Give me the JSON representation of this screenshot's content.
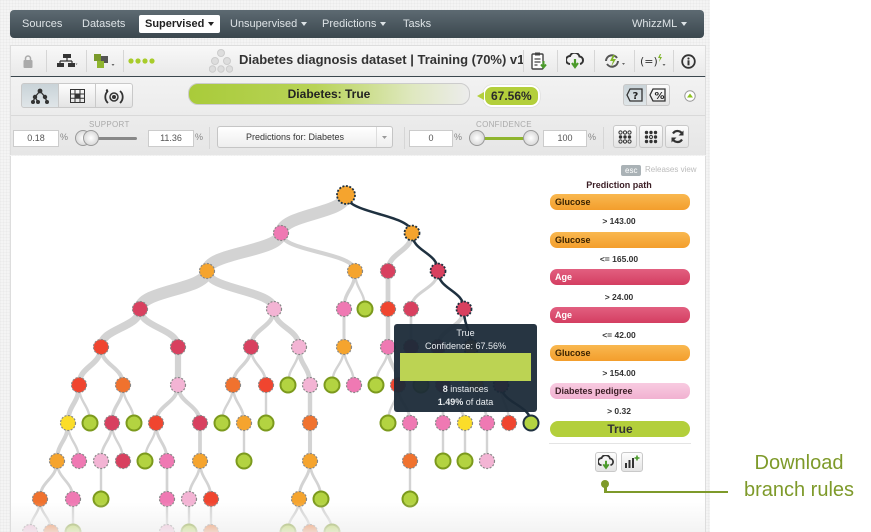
{
  "navbar": {
    "items": [
      {
        "label": "Sources",
        "active": false,
        "caret": false
      },
      {
        "label": "Datasets",
        "active": false,
        "caret": false
      },
      {
        "label": "Supervised",
        "active": true,
        "caret": true
      },
      {
        "label": "Unsupervised",
        "active": false,
        "caret": true
      },
      {
        "label": "Predictions",
        "active": false,
        "caret": true
      },
      {
        "label": "Tasks",
        "active": false,
        "caret": false
      }
    ],
    "right_menu": "WhizzML"
  },
  "toolbar": {
    "title": "Diabetes diagnosis dataset | Training (70%) v1",
    "icons": [
      "lock-icon",
      "tree-view-icon",
      "model-type-icon",
      "progress-dots-icon",
      "model-tree-icon",
      "report-download-icon",
      "cloud-download-icon",
      "batch-predict-icon",
      "formula-icon",
      "info-icon"
    ]
  },
  "view_controls": {
    "views": [
      "tree-view",
      "sunburst-grid-view",
      "radar-view"
    ],
    "prediction_label": "Diabetes: True",
    "confidence_value": "67.56%",
    "accent_color": "#b3cf3b"
  },
  "filters": {
    "support": {
      "label": "SUPPORT",
      "min": "0.18",
      "max": "11.36",
      "unit": "%"
    },
    "prediction_dropdown": "Predictions for: Diabetes",
    "confidence": {
      "label": "CONFIDENCE",
      "min": "0",
      "max": "100",
      "unit": "%"
    }
  },
  "sidebar": {
    "esc_label": "esc",
    "releases_label": "Releases view",
    "title": "Prediction path",
    "path": [
      {
        "field": "Glucose",
        "condition": "> 143.00",
        "color": "#f5a43a"
      },
      {
        "field": "Glucose",
        "condition": "<= 165.00",
        "color": "#f5a43a"
      },
      {
        "field": "Age",
        "condition": "> 24.00",
        "color": "#d94a6b"
      },
      {
        "field": "Age",
        "condition": "<= 42.00",
        "color": "#d94a6b"
      },
      {
        "field": "Glucose",
        "condition": "> 154.00",
        "color": "#f5a43a"
      },
      {
        "field": "Diabetes pedigree",
        "condition": "> 0.32",
        "color": "#f4b8d6"
      }
    ],
    "leaf": "True"
  },
  "tooltip": {
    "title": "True",
    "confidence": "Confidence: 67.56%",
    "instances_count": "8",
    "instances_label": "instances",
    "data_pct": "1.49%",
    "data_label": "of data"
  },
  "annotation": {
    "line1": "Download",
    "line2": "branch rules"
  },
  "tree": {
    "colors": {
      "O": "#f5a42e",
      "P": "#ef79b3",
      "L": "#f3b4d4",
      "R": "#d8405f",
      "E": "#f0452f",
      "D": "#f0722e",
      "Y": "#fbdd29",
      "G": "#b3d341"
    },
    "nodes": [
      [
        "n0",
        345,
        195,
        "O",
        null,
        1
      ],
      [
        "n1",
        280,
        233,
        "P",
        "n0",
        0
      ],
      [
        "n2",
        411,
        233,
        "O",
        "n0",
        1
      ],
      [
        "n3",
        206,
        271,
        "O",
        "n1",
        0
      ],
      [
        "n4",
        354,
        271,
        "O",
        "n1",
        0
      ],
      [
        "n5",
        387,
        271,
        "R",
        "n2",
        0
      ],
      [
        "n6",
        437,
        271,
        "R",
        "n2",
        1
      ],
      [
        "n7",
        139,
        309,
        "R",
        "n3",
        0
      ],
      [
        "n8",
        273,
        309,
        "L",
        "n3",
        0
      ],
      [
        "n9",
        343,
        309,
        "P",
        "n4",
        0
      ],
      [
        "n10",
        364,
        309,
        "G",
        "n4",
        0
      ],
      [
        "n11",
        387,
        309,
        "E",
        "n5",
        0
      ],
      [
        "n12",
        410,
        309,
        "R",
        "n6",
        0
      ],
      [
        "n13",
        463,
        309,
        "R",
        "n6",
        1
      ],
      [
        "n14",
        100,
        347,
        "E",
        "n7",
        0
      ],
      [
        "n15",
        177,
        347,
        "R",
        "n7",
        0
      ],
      [
        "n16",
        250,
        347,
        "R",
        "n8",
        0
      ],
      [
        "n17",
        298,
        347,
        "L",
        "n8",
        0
      ],
      [
        "n18",
        343,
        347,
        "O",
        "n9",
        0
      ],
      [
        "n19",
        387,
        347,
        "P",
        "n11",
        0
      ],
      [
        "n20",
        410,
        347,
        "R",
        "n12",
        0
      ],
      [
        "n21",
        437,
        347,
        "R",
        "n13",
        0
      ],
      [
        "n22",
        470,
        347,
        "O",
        "n13",
        1
      ],
      [
        "n23",
        78,
        385,
        "E",
        "n14",
        0
      ],
      [
        "n24",
        122,
        385,
        "D",
        "n14",
        0
      ],
      [
        "n25",
        177,
        385,
        "L",
        "n15",
        0
      ],
      [
        "n26",
        232,
        385,
        "D",
        "n16",
        0
      ],
      [
        "n27",
        265,
        385,
        "E",
        "n16",
        0
      ],
      [
        "n28",
        287,
        385,
        "G",
        "n17",
        0
      ],
      [
        "n29",
        309,
        385,
        "L",
        "n17",
        0
      ],
      [
        "n30",
        331,
        385,
        "G",
        "n18",
        0
      ],
      [
        "n31",
        353,
        385,
        "P",
        "n18",
        0
      ],
      [
        "n32",
        375,
        385,
        "G",
        "n19",
        0
      ],
      [
        "n33",
        397,
        385,
        "E",
        "n19",
        0
      ],
      [
        "n34",
        420,
        385,
        "G",
        "n20",
        0
      ],
      [
        "n35",
        442,
        385,
        "R",
        "n21",
        0
      ],
      [
        "n36",
        475,
        385,
        "O",
        "n22",
        0
      ],
      [
        "n37",
        500,
        385,
        "R",
        "n22",
        1
      ],
      [
        "n38",
        67,
        423,
        "Y",
        "n23",
        0
      ],
      [
        "n39",
        89,
        423,
        "G",
        "n23",
        0
      ],
      [
        "n40",
        111,
        423,
        "R",
        "n24",
        0
      ],
      [
        "n41",
        133,
        423,
        "G",
        "n24",
        0
      ],
      [
        "n42",
        155,
        423,
        "E",
        "n25",
        0
      ],
      [
        "n43",
        199,
        423,
        "R",
        "n25",
        0
      ],
      [
        "n44",
        221,
        423,
        "G",
        "n26",
        0
      ],
      [
        "n45",
        243,
        423,
        "O",
        "n26",
        0
      ],
      [
        "n46",
        265,
        423,
        "G",
        "n27",
        0
      ],
      [
        "n47",
        309,
        423,
        "D",
        "n29",
        0
      ],
      [
        "n48",
        387,
        423,
        "G",
        "n33",
        0
      ],
      [
        "n49",
        409,
        423,
        "P",
        "n33",
        0
      ],
      [
        "n50",
        442,
        423,
        "P",
        "n35",
        0
      ],
      [
        "n51",
        464,
        423,
        "Y",
        "n35",
        0
      ],
      [
        "n52",
        486,
        423,
        "P",
        "n36",
        0
      ],
      [
        "n53",
        508,
        423,
        "E",
        "n37",
        0
      ],
      [
        "n54",
        530,
        423,
        "G",
        "n37",
        1
      ],
      [
        "n55",
        56,
        461,
        "O",
        "n38",
        0
      ],
      [
        "n56",
        78,
        461,
        "P",
        "n38",
        0
      ],
      [
        "n57",
        100,
        461,
        "L",
        "n40",
        0
      ],
      [
        "n58",
        122,
        461,
        "R",
        "n40",
        0
      ],
      [
        "n59",
        144,
        461,
        "G",
        "n42",
        0
      ],
      [
        "n60",
        166,
        461,
        "P",
        "n42",
        0
      ],
      [
        "n61",
        199,
        461,
        "O",
        "n43",
        0
      ],
      [
        "n62",
        243,
        461,
        "G",
        "n45",
        0
      ],
      [
        "n63",
        309,
        461,
        "O",
        "n47",
        0
      ],
      [
        "n64",
        409,
        461,
        "D",
        "n49",
        0
      ],
      [
        "n65",
        442,
        461,
        "G",
        "n50",
        0
      ],
      [
        "n66",
        464,
        461,
        "G",
        "n51",
        0
      ],
      [
        "n67",
        486,
        461,
        "L",
        "n52",
        0
      ],
      [
        "n68",
        39,
        499,
        "D",
        "n55",
        0
      ],
      [
        "n69",
        72,
        499,
        "P",
        "n55",
        0
      ],
      [
        "n70",
        100,
        499,
        "G",
        "n57",
        0
      ],
      [
        "n71",
        166,
        499,
        "P",
        "n60",
        0
      ],
      [
        "n72",
        188,
        499,
        "L",
        "n61",
        0
      ],
      [
        "n73",
        210,
        499,
        "E",
        "n61",
        0
      ],
      [
        "n74",
        298,
        499,
        "O",
        "n63",
        0
      ],
      [
        "n75",
        320,
        499,
        "G",
        "n63",
        0
      ],
      [
        "n76",
        409,
        499,
        "G",
        "n64",
        0
      ],
      [
        "n77",
        29,
        532,
        "L",
        "n68",
        0
      ],
      [
        "n78",
        50,
        532,
        "D",
        "n68",
        0
      ],
      [
        "n79",
        72,
        532,
        "G",
        "n69",
        0
      ],
      [
        "n80",
        166,
        532,
        "L",
        "n71",
        0
      ],
      [
        "n81",
        188,
        532,
        "G",
        "n72",
        0
      ],
      [
        "n82",
        210,
        532,
        "D",
        "n73",
        0
      ],
      [
        "n83",
        287,
        532,
        "G",
        "n74",
        0
      ],
      [
        "n84",
        309,
        532,
        "D",
        "n74",
        0
      ],
      [
        "n85",
        331,
        532,
        "G",
        "n75",
        0
      ]
    ]
  }
}
